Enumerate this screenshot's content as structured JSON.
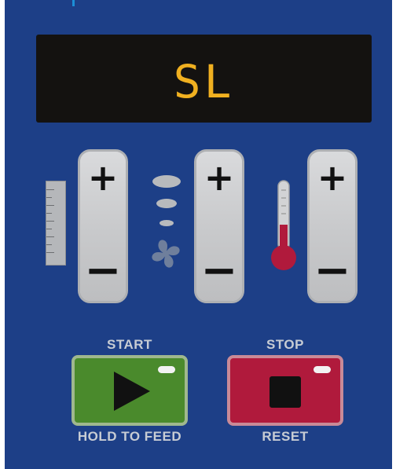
{
  "display": {
    "text": "SL",
    "text_color": "#f0b020"
  },
  "controls": {
    "feed_rate": {
      "plus": "+",
      "minus": "−",
      "icon": "ruler-icon"
    },
    "fan_speed": {
      "plus": "+",
      "minus": "−",
      "icon": "fan-icon"
    },
    "temperature": {
      "plus": "+",
      "minus": "−",
      "icon": "thermometer-icon"
    }
  },
  "start": {
    "top_label": "START",
    "bottom_label": "HOLD TO FEED",
    "icon": "play-icon",
    "color": "#4a8a2c"
  },
  "stop": {
    "top_label": "STOP",
    "bottom_label": "RESET",
    "icon": "stop-icon",
    "color": "#b01a3c"
  },
  "colors": {
    "panel": "#1d3f87",
    "display_bg": "#141210",
    "thermo_fill": "#b01a3c"
  }
}
